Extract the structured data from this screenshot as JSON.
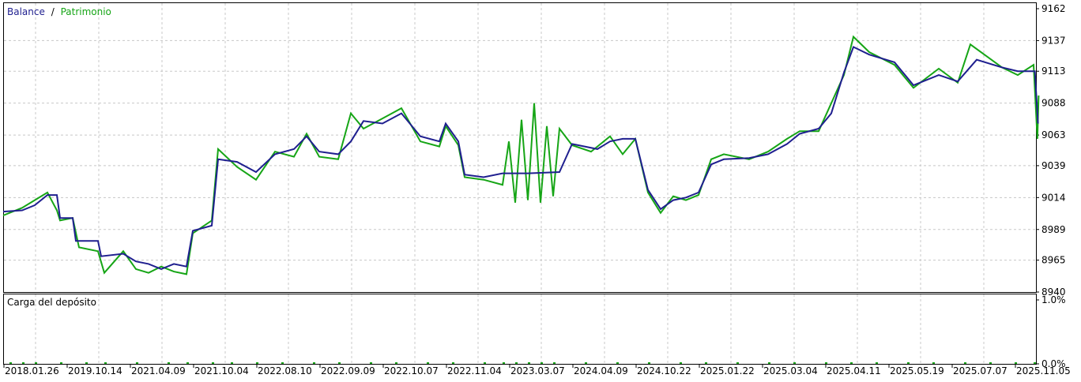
{
  "legend": {
    "balance_label": "Balance",
    "separator": "/",
    "equity_label": "Patrimonio"
  },
  "colors": {
    "balance": "#1f1f8f",
    "equity": "#16a516",
    "grid": "#c8c8c8",
    "axis": "#000000",
    "load_bars": "#16a516"
  },
  "chart_data": [
    {
      "type": "line",
      "title": "",
      "legend": [
        "Balance",
        "Patrimonio"
      ],
      "legend_placement": "top-left",
      "grid": true,
      "ylim": [
        8940,
        9162
      ],
      "y_ticks": [
        "9162",
        "9137",
        "9113",
        "9088",
        "9063",
        "9039",
        "9014",
        "8989",
        "8965",
        "8940"
      ],
      "x_tick_labels": [
        "2018.01.26",
        "2019.10.14",
        "2021.04.09",
        "2021.10.04",
        "2022.08.10",
        "2022.09.09",
        "2022.10.07",
        "2022.11.04",
        "2023.03.07",
        "2024.04.09",
        "2024.10.22",
        "2025.01.22",
        "2025.03.04",
        "2025.04.11",
        "2025.05.19",
        "2025.07.07",
        "2025.11.05"
      ],
      "x_range": [
        0,
        16
      ],
      "series": [
        {
          "name": "Balance",
          "points": [
            [
              0,
              9003
            ],
            [
              0.3,
              9004
            ],
            [
              0.5,
              9008
            ],
            [
              0.7,
              9016
            ],
            [
              0.85,
              9016
            ],
            [
              0.9,
              8998
            ],
            [
              1.1,
              8998
            ],
            [
              1.15,
              8980
            ],
            [
              1.5,
              8980
            ],
            [
              1.55,
              8968
            ],
            [
              1.9,
              8970
            ],
            [
              2.1,
              8964
            ],
            [
              2.3,
              8962
            ],
            [
              2.5,
              8958
            ],
            [
              2.7,
              8962
            ],
            [
              2.9,
              8960
            ],
            [
              3.0,
              8988
            ],
            [
              3.3,
              8992
            ],
            [
              3.4,
              9044
            ],
            [
              3.7,
              9042
            ],
            [
              4.0,
              9034
            ],
            [
              4.3,
              9048
            ],
            [
              4.6,
              9052
            ],
            [
              4.8,
              9062
            ],
            [
              5.0,
              9050
            ],
            [
              5.3,
              9048
            ],
            [
              5.5,
              9058
            ],
            [
              5.7,
              9074
            ],
            [
              6.0,
              9072
            ],
            [
              6.3,
              9080
            ],
            [
              6.6,
              9062
            ],
            [
              6.9,
              9058
            ],
            [
              7.0,
              9072
            ],
            [
              7.2,
              9058
            ],
            [
              7.3,
              9032
            ],
            [
              7.6,
              9030
            ],
            [
              7.9,
              9033
            ],
            [
              8.3,
              9033
            ],
            [
              8.8,
              9034
            ],
            [
              9.0,
              9056
            ],
            [
              9.4,
              9052
            ],
            [
              9.6,
              9058
            ],
            [
              9.8,
              9060
            ],
            [
              10.0,
              9060
            ],
            [
              10.2,
              9020
            ],
            [
              10.4,
              9005
            ],
            [
              10.6,
              9012
            ],
            [
              10.8,
              9014
            ],
            [
              11.0,
              9018
            ],
            [
              11.2,
              9040
            ],
            [
              11.4,
              9044
            ],
            [
              11.8,
              9045
            ],
            [
              12.1,
              9048
            ],
            [
              12.4,
              9056
            ],
            [
              12.6,
              9064
            ],
            [
              12.9,
              9068
            ],
            [
              13.1,
              9080
            ],
            [
              13.3,
              9112
            ],
            [
              13.45,
              9132
            ],
            [
              13.7,
              9126
            ],
            [
              14.1,
              9120
            ],
            [
              14.4,
              9102
            ],
            [
              14.8,
              9110
            ],
            [
              15.1,
              9105
            ],
            [
              15.4,
              9122
            ],
            [
              15.8,
              9116
            ],
            [
              16.05,
              9113
            ],
            [
              16.32,
              9113
            ],
            [
              16.37,
              9072
            ]
          ]
        },
        {
          "name": "Patrimonio",
          "points": [
            [
              0,
              9000
            ],
            [
              0.3,
              9006
            ],
            [
              0.5,
              9012
            ],
            [
              0.7,
              9018
            ],
            [
              0.85,
              9004
            ],
            [
              0.9,
              8996
            ],
            [
              1.1,
              8998
            ],
            [
              1.2,
              8975
            ],
            [
              1.5,
              8972
            ],
            [
              1.6,
              8955
            ],
            [
              1.9,
              8972
            ],
            [
              2.1,
              8958
            ],
            [
              2.3,
              8955
            ],
            [
              2.5,
              8960
            ],
            [
              2.7,
              8956
            ],
            [
              2.9,
              8954
            ],
            [
              3.0,
              8986
            ],
            [
              3.3,
              8996
            ],
            [
              3.4,
              9052
            ],
            [
              3.7,
              9038
            ],
            [
              4.0,
              9028
            ],
            [
              4.3,
              9050
            ],
            [
              4.6,
              9046
            ],
            [
              4.8,
              9064
            ],
            [
              5.0,
              9046
            ],
            [
              5.3,
              9044
            ],
            [
              5.5,
              9080
            ],
            [
              5.7,
              9068
            ],
            [
              6.0,
              9076
            ],
            [
              6.3,
              9084
            ],
            [
              6.6,
              9058
            ],
            [
              6.9,
              9054
            ],
            [
              7.0,
              9070
            ],
            [
              7.2,
              9055
            ],
            [
              7.3,
              9030
            ],
            [
              7.6,
              9028
            ],
            [
              7.9,
              9024
            ],
            [
              8.0,
              9058
            ],
            [
              8.1,
              9010
            ],
            [
              8.2,
              9075
            ],
            [
              8.3,
              9012
            ],
            [
              8.4,
              9088
            ],
            [
              8.5,
              9010
            ],
            [
              8.6,
              9070
            ],
            [
              8.7,
              9015
            ],
            [
              8.8,
              9068
            ],
            [
              9.0,
              9055
            ],
            [
              9.3,
              9050
            ],
            [
              9.6,
              9062
            ],
            [
              9.8,
              9048
            ],
            [
              10.0,
              9060
            ],
            [
              10.2,
              9018
            ],
            [
              10.4,
              9002
            ],
            [
              10.6,
              9015
            ],
            [
              10.8,
              9012
            ],
            [
              11.0,
              9016
            ],
            [
              11.2,
              9044
            ],
            [
              11.4,
              9048
            ],
            [
              11.8,
              9044
            ],
            [
              12.1,
              9050
            ],
            [
              12.4,
              9060
            ],
            [
              12.6,
              9066
            ],
            [
              12.9,
              9066
            ],
            [
              13.1,
              9088
            ],
            [
              13.3,
              9110
            ],
            [
              13.45,
              9140
            ],
            [
              13.7,
              9128
            ],
            [
              14.1,
              9118
            ],
            [
              14.4,
              9100
            ],
            [
              14.8,
              9115
            ],
            [
              15.1,
              9104
            ],
            [
              15.3,
              9134
            ],
            [
              15.8,
              9116
            ],
            [
              16.05,
              9110
            ],
            [
              16.3,
              9118
            ],
            [
              16.36,
              9060
            ],
            [
              16.38,
              9094
            ]
          ]
        }
      ]
    },
    {
      "type": "bar",
      "title": "Carga del depósito",
      "legend_placement": "top-left",
      "grid": true,
      "ylim": [
        0.0,
        1.0
      ],
      "y_ticks": [
        "1.0%",
        "0.0%"
      ],
      "series": [
        {
          "name": "Carga del depósito",
          "x": [
            0.1,
            0.3,
            0.5,
            0.9,
            1.3,
            1.6,
            2.1,
            2.6,
            2.9,
            3.3,
            3.6,
            4.0,
            4.4,
            4.9,
            5.3,
            5.8,
            6.2,
            6.7,
            7.1,
            7.6,
            7.9,
            8.1,
            8.3,
            8.5,
            8.7,
            9.2,
            9.7,
            10.2,
            10.7,
            11.1,
            11.6,
            12.1,
            12.5,
            13.0,
            13.4,
            13.8,
            14.3,
            14.7,
            15.2,
            15.6,
            16.0,
            16.3
          ],
          "values": [
            0.003,
            0.003,
            0.003,
            0.003,
            0.003,
            0.003,
            0.003,
            0.003,
            0.003,
            0.003,
            0.003,
            0.003,
            0.003,
            0.003,
            0.003,
            0.003,
            0.003,
            0.003,
            0.003,
            0.003,
            0.003,
            0.003,
            0.003,
            0.003,
            0.003,
            0.003,
            0.003,
            0.003,
            0.003,
            0.003,
            0.003,
            0.003,
            0.003,
            0.003,
            0.003,
            0.003,
            0.003,
            0.003,
            0.003,
            0.003,
            0.003,
            0.003
          ]
        }
      ]
    }
  ]
}
